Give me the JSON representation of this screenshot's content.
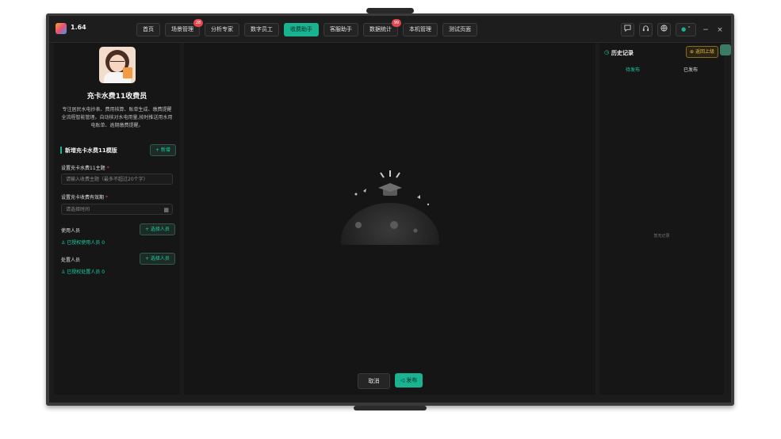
{
  "app": {
    "version": "1.64"
  },
  "nav": {
    "tabs": [
      {
        "label": "首页",
        "badge": ""
      },
      {
        "label": "场景管理",
        "badge": "28"
      },
      {
        "label": "分析专家",
        "badge": ""
      },
      {
        "label": "数字员工",
        "badge": ""
      },
      {
        "label": "收费助手",
        "badge": "",
        "active": true
      },
      {
        "label": "客服助手",
        "badge": ""
      },
      {
        "label": "数据统计",
        "badge": "99"
      },
      {
        "label": "本机管理",
        "badge": ""
      },
      {
        "label": "测试页面",
        "badge": ""
      }
    ],
    "icons": [
      "chat-icon",
      "headset-icon",
      "globe-icon",
      "user-icon"
    ],
    "window_controls": {
      "minimize": "−",
      "close": "×"
    }
  },
  "profile": {
    "title": "充卡水费11收费员",
    "description": "专注居民水电抄表、费用核算、账单生成、缴费提醒全流程智能管理。自动核对水电用量,按时推送用水用电账单、逾期缴费提醒。"
  },
  "form": {
    "section_title": "新增充卡水费11模版",
    "add_label": "+ 新增",
    "topic_label": "设置充卡水费11主题",
    "topic_placeholder": "请输入收费主题（最多不超过20个字）",
    "validity_label": "设置充卡收费有效期",
    "validity_placeholder": "请选择时间",
    "user_label": "使用人员",
    "user_select": "+ 选择人员",
    "user_auth": "已授权使用人员 0",
    "handler_label": "处置人员",
    "handler_select": "+ 选择人员",
    "handler_auth": "已授权处置人员 0",
    "required_mark": "*"
  },
  "actions": {
    "cancel": "取消",
    "publish": "发布"
  },
  "history": {
    "title": "历史记录",
    "back": "返回上级",
    "tabs": [
      "待发布",
      "已发布"
    ],
    "empty": "暂无记录"
  },
  "colors": {
    "accent": "#19b391",
    "badge": "#e0484e",
    "warning": "#e8b64a"
  }
}
